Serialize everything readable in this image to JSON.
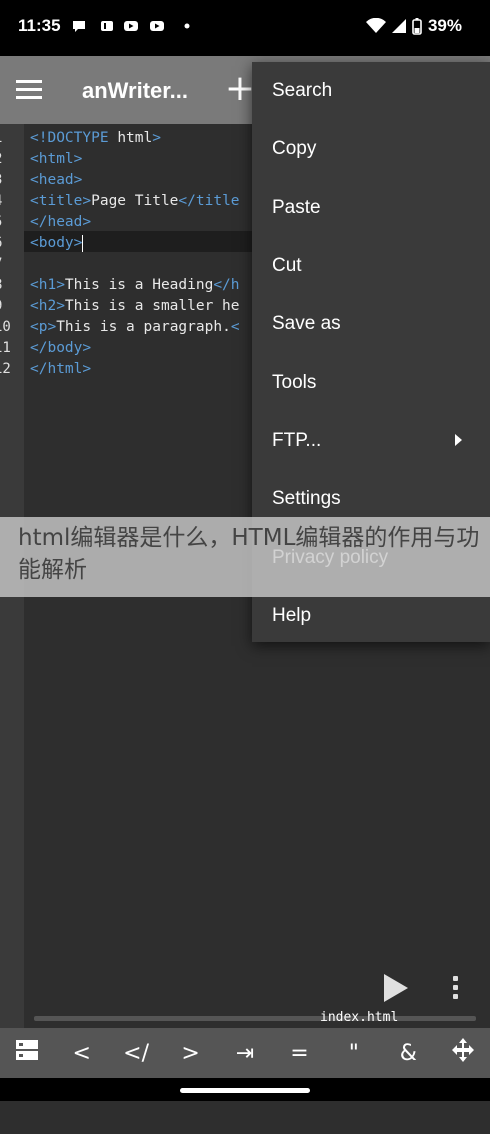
{
  "status": {
    "time": "11:35",
    "battery": "39%",
    "notifications": [
      "chat-icon",
      "tiktok-icon",
      "youtube-icon",
      "youtube-icon",
      "dot-icon"
    ]
  },
  "toolbar": {
    "title": "anWriter..."
  },
  "editor": {
    "line_numbers": [
      "1",
      "2",
      "3",
      "4",
      "5",
      "6",
      "7",
      "8",
      "9",
      "10",
      "11",
      "12"
    ],
    "lines": [
      [
        {
          "t": "<!DOCTYPE ",
          "c": "tag"
        },
        {
          "t": "html",
          "c": "txt"
        },
        {
          "t": ">",
          "c": "tag"
        }
      ],
      [
        {
          "t": "<html>",
          "c": "tag"
        }
      ],
      [
        {
          "t": "<head>",
          "c": "tag"
        }
      ],
      [
        {
          "t": "<title>",
          "c": "tag"
        },
        {
          "t": "Page Title",
          "c": "txt"
        },
        {
          "t": "</title",
          "c": "tag"
        }
      ],
      [
        {
          "t": "</head>",
          "c": "tag"
        }
      ],
      [
        {
          "t": "<body>",
          "c": "tag"
        }
      ],
      [],
      [
        {
          "t": "<h1>",
          "c": "tag"
        },
        {
          "t": "This is a Heading",
          "c": "txt"
        },
        {
          "t": "</h",
          "c": "tag"
        }
      ],
      [
        {
          "t": "<h2>",
          "c": "tag"
        },
        {
          "t": "This is a smaller he",
          "c": "txt"
        }
      ],
      [
        {
          "t": "<p>",
          "c": "tag"
        },
        {
          "t": "This is a paragraph.",
          "c": "txt"
        },
        {
          "t": "<",
          "c": "tag"
        }
      ],
      [
        {
          "t": "</body>",
          "c": "tag"
        }
      ],
      [
        {
          "t": "</html>",
          "c": "tag"
        }
      ]
    ],
    "filename": "index.html"
  },
  "menu": {
    "items": [
      "Search",
      "Copy",
      "Paste",
      "Cut",
      "Save as",
      "Tools",
      "FTP...",
      "Settings",
      "Privacy policy",
      "Help"
    ]
  },
  "overlay": {
    "text": "html编辑器是什么，HTML编辑器的作用与功能解析"
  },
  "keybar": {
    "keys": [
      "",
      "<",
      "</",
      ">",
      "⇥",
      "=",
      "\"",
      "&",
      ""
    ]
  },
  "colors": {
    "tag": "#5b9bd5",
    "toolbar": "#7a7a7a",
    "menu": "#3a3a3a"
  }
}
